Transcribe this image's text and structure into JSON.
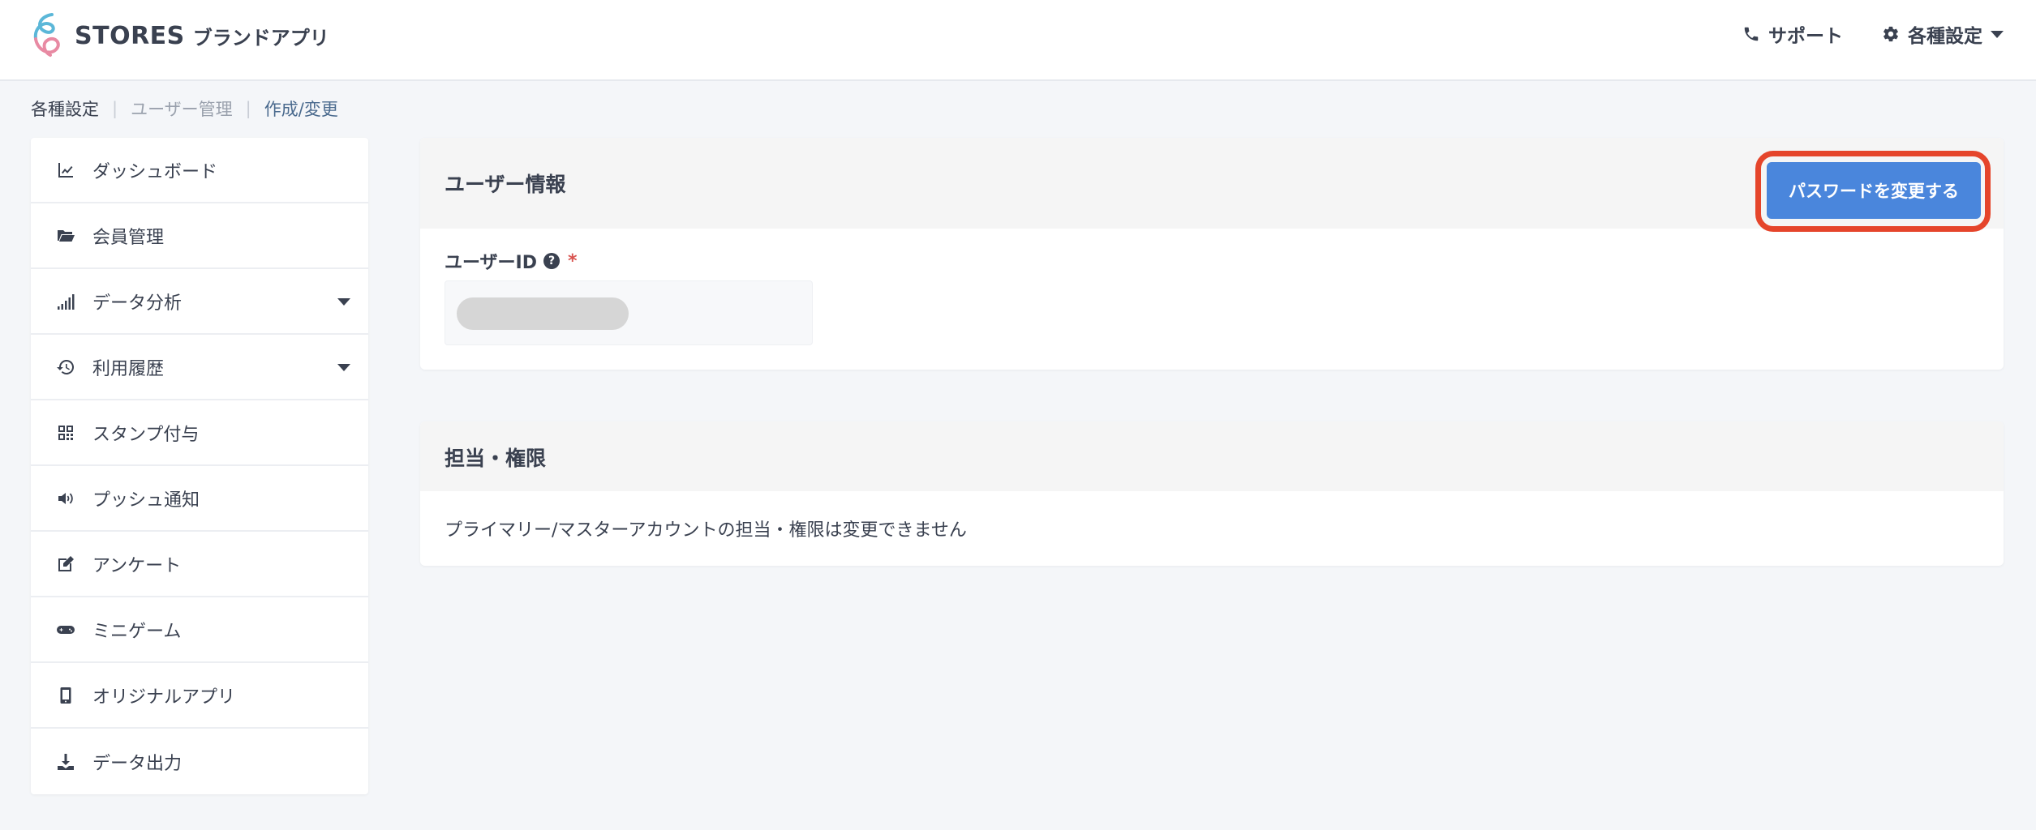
{
  "header": {
    "logo_text": "STORES",
    "logo_sub": "ブランドアプリ",
    "support_label": "サポート",
    "settings_label": "各種設定"
  },
  "breadcrumb": [
    {
      "label": "各種設定"
    },
    {
      "label": "ユーザー管理"
    },
    {
      "label": "作成/変更"
    }
  ],
  "sidebar": {
    "items": [
      {
        "label": "ダッシュボード",
        "icon": "chart-line-icon"
      },
      {
        "label": "会員管理",
        "icon": "folder-open-icon"
      },
      {
        "label": "データ分析",
        "icon": "signal-bars-icon",
        "has_submenu": true
      },
      {
        "label": "利用履歴",
        "icon": "history-icon",
        "has_submenu": true
      },
      {
        "label": "スタンプ付与",
        "icon": "qrcode-icon"
      },
      {
        "label": "プッシュ通知",
        "icon": "volume-icon"
      },
      {
        "label": "アンケート",
        "icon": "edit-icon"
      },
      {
        "label": "ミニゲーム",
        "icon": "gamepad-icon"
      },
      {
        "label": "オリジナルアプリ",
        "icon": "mobile-icon"
      },
      {
        "label": "データ出力",
        "icon": "download-icon"
      }
    ]
  },
  "user_info": {
    "title": "ユーザー情報",
    "change_password_label": "パスワードを変更する",
    "user_id_label": "ユーザーID",
    "help_glyph": "?",
    "required_mark": "*"
  },
  "role": {
    "title": "担当・権限",
    "message": "プライマリー/マスターアカウントの担当・権限は変更できません"
  },
  "colors": {
    "primary_button": "#4a86dc",
    "highlight_outline": "#e5452b",
    "text": "#3a4150"
  }
}
